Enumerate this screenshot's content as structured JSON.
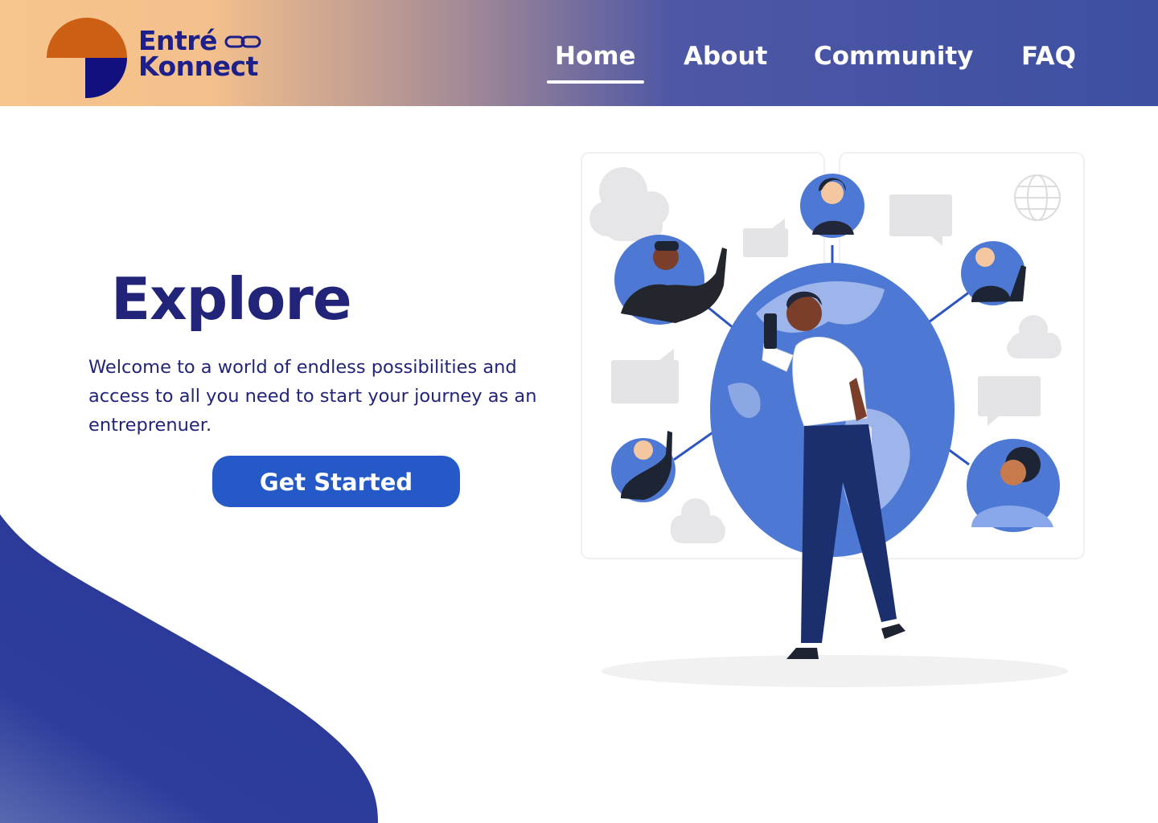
{
  "brand": {
    "line1": "Entré",
    "line2": "Konnect",
    "colors": {
      "orange": "#cb5f14",
      "navy": "#1d1f8a"
    }
  },
  "nav": {
    "items": [
      {
        "label": "Home",
        "active": true
      },
      {
        "label": "About",
        "active": false
      },
      {
        "label": "Community",
        "active": false
      },
      {
        "label": "FAQ",
        "active": false
      }
    ]
  },
  "hero": {
    "title": "Explore",
    "text": "Welcome to a world of endless possibilities and access to all you need to start your journey as an entreprenuer.",
    "cta_label": "Get Started"
  },
  "colors": {
    "primary": "#2659c8",
    "heading": "#22247a",
    "wave": "#2a3a98",
    "globe": "#4d78d4"
  }
}
